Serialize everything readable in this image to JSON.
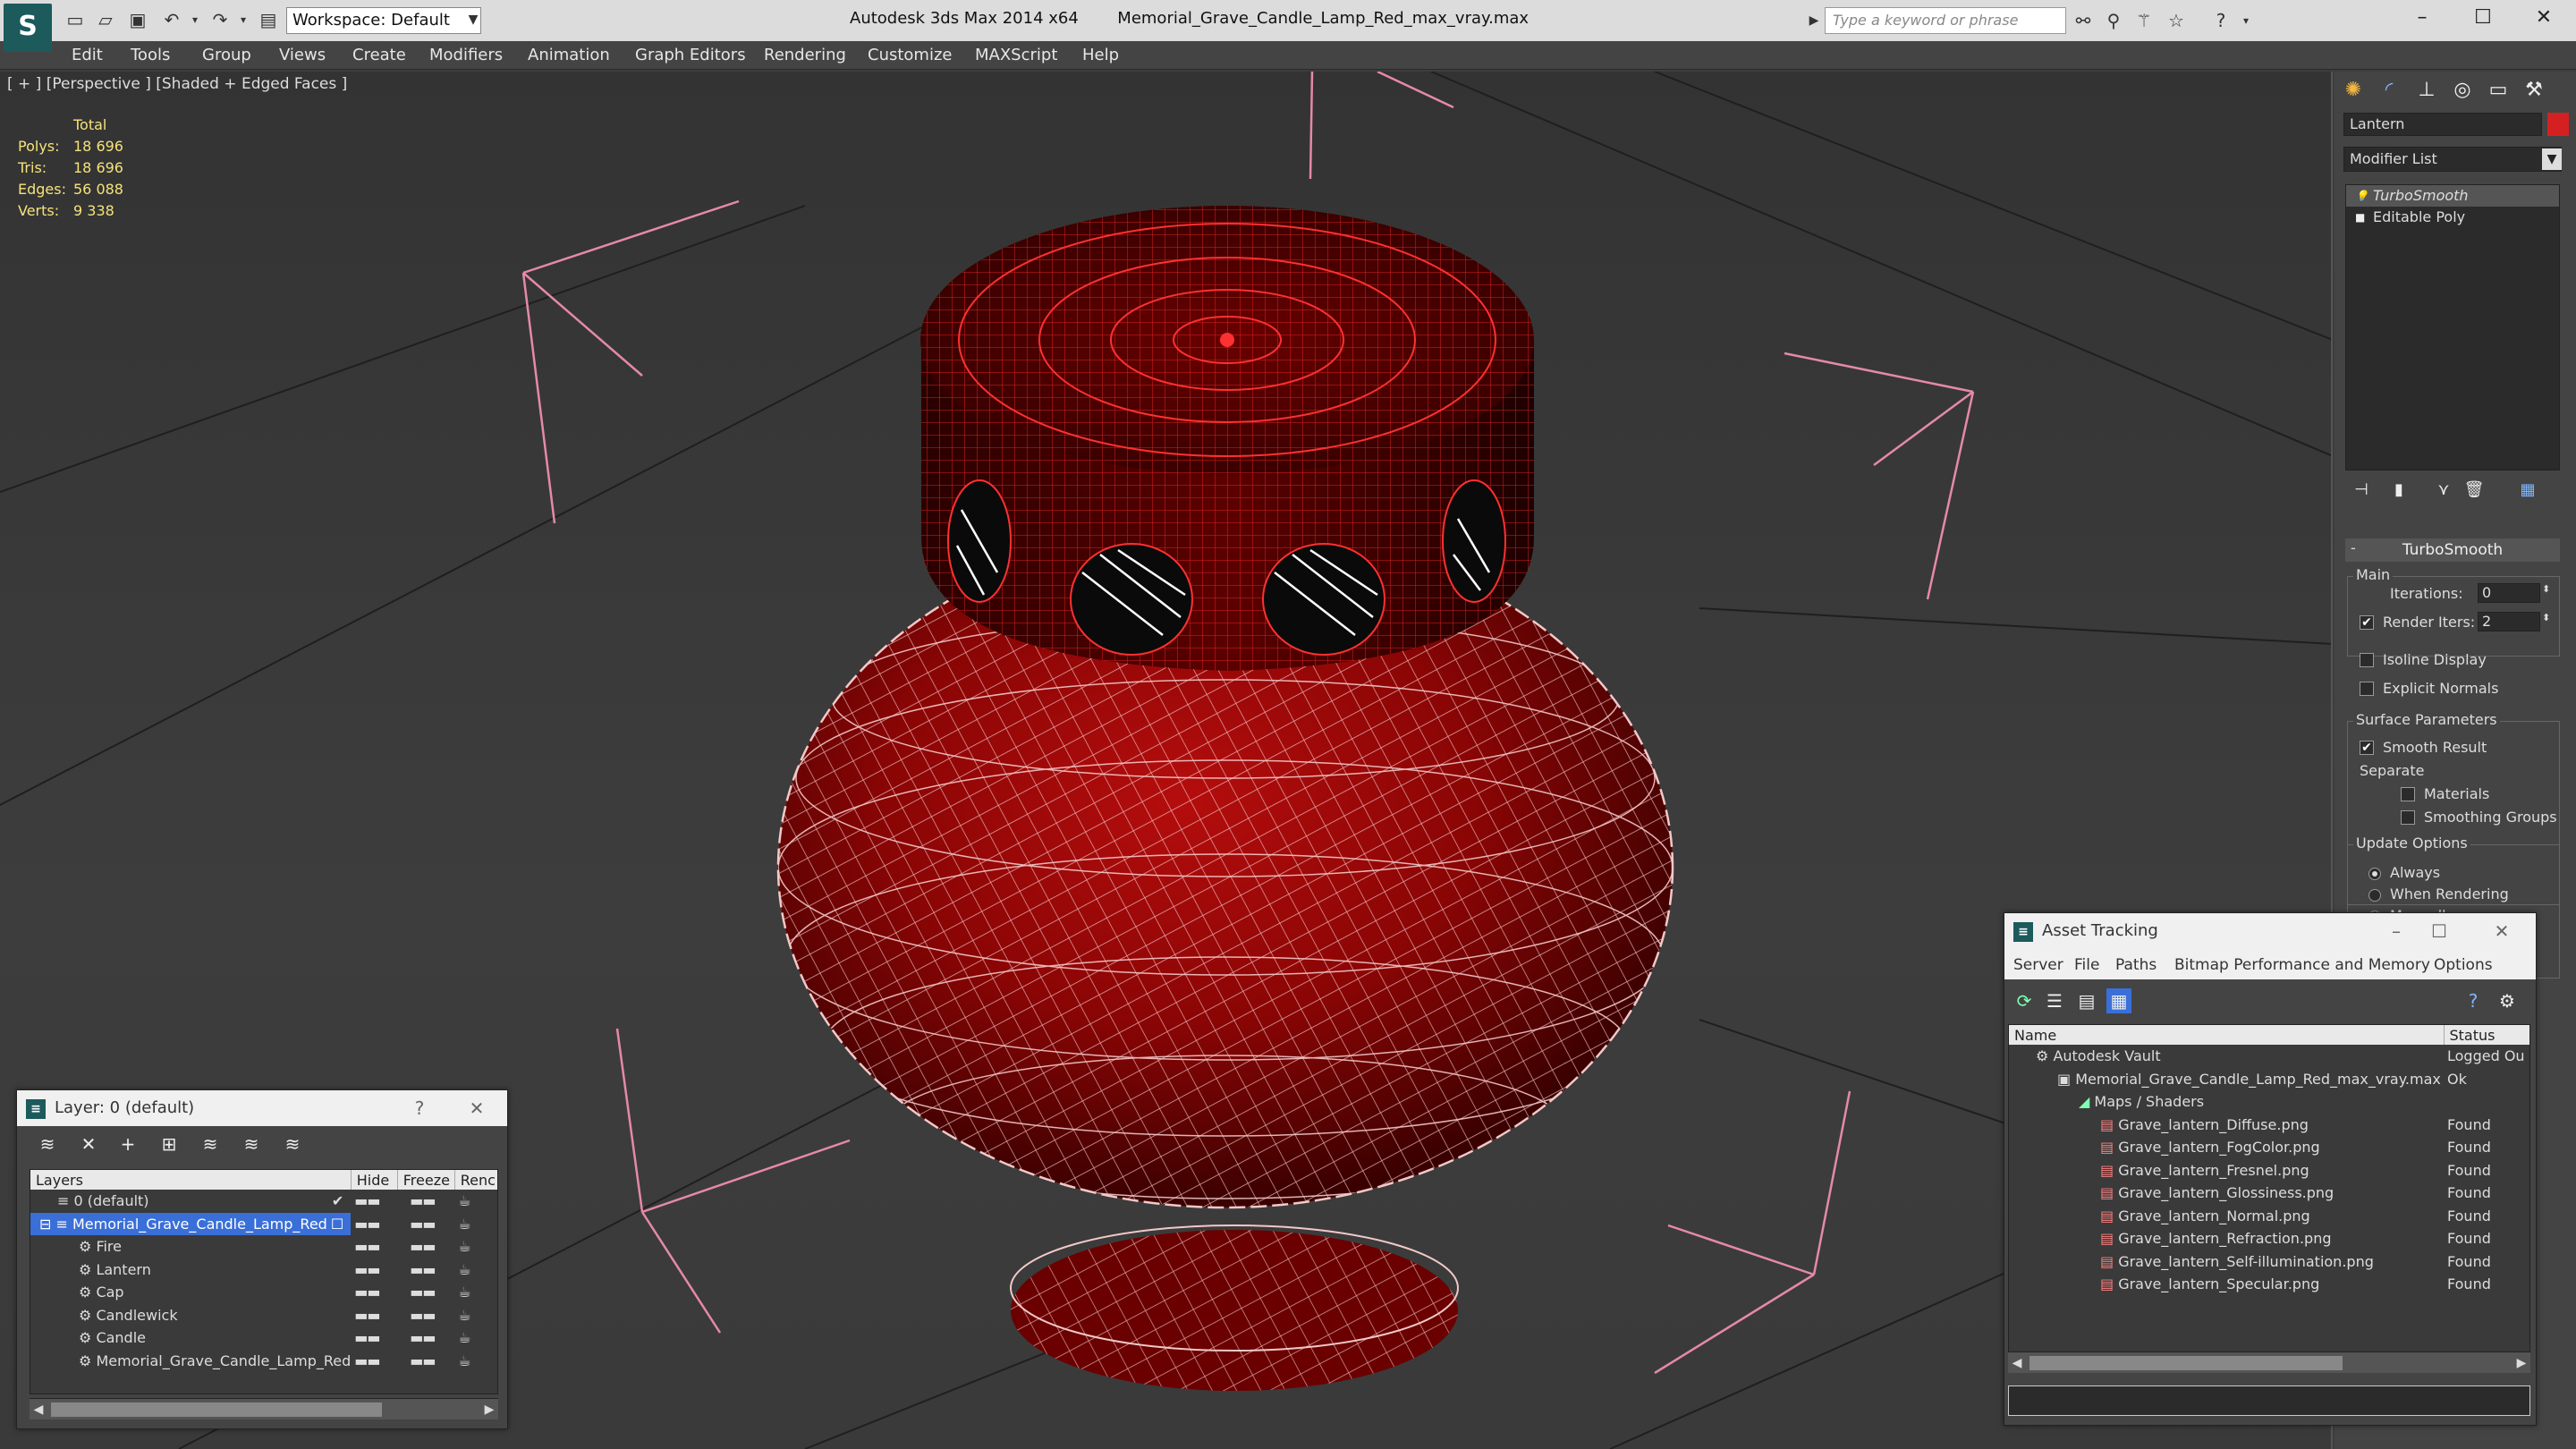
{
  "title_bar": {
    "workspace": "Workspace: Default",
    "app_name": "Autodesk 3ds Max  2014 x64",
    "file_name": "Memorial_Grave_Candle_Lamp_Red_max_vray.max",
    "search_placeholder": "Type a keyword or phrase"
  },
  "menu": [
    "Edit",
    "Tools",
    "Group",
    "Views",
    "Create",
    "Modifiers",
    "Animation",
    "Graph Editors",
    "Rendering",
    "Customize",
    "MAXScript",
    "Help"
  ],
  "viewport": {
    "label": "[ + ] [Perspective ] [Shaded + Edged Faces ]",
    "stats_header": "Total",
    "stats": [
      {
        "k": "Polys:",
        "v": "18 696"
      },
      {
        "k": "Tris:",
        "v": "18 696"
      },
      {
        "k": "Edges:",
        "v": "56 088"
      },
      {
        "k": "Verts:",
        "v": "9 338"
      }
    ]
  },
  "command_panel": {
    "object_name": "Lantern",
    "object_color": "#d42020",
    "modifier_list": "Modifier List",
    "stack": [
      "TurboSmooth",
      "Editable Poly"
    ],
    "rollout_title": "TurboSmooth",
    "main_group": "Main",
    "iterations_label": "Iterations:",
    "iterations_value": "0",
    "render_iters_label": "Render Iters:",
    "render_iters_value": "2",
    "isoline": "Isoline Display",
    "explicit_normals": "Explicit Normals",
    "surface_group": "Surface Parameters",
    "smooth_result": "Smooth Result",
    "separate": "Separate",
    "materials": "Materials",
    "smoothing_groups": "Smoothing Groups",
    "update_group": "Update Options",
    "always": "Always",
    "when_rendering": "When Rendering",
    "manually": "Manually"
  },
  "layer_window": {
    "title": "Layer: 0 (default)",
    "help": "?",
    "columns": [
      "Layers",
      "Hide",
      "Freeze",
      "Renc"
    ],
    "rows": [
      {
        "name": "0 (default)",
        "level": 0,
        "selected": false,
        "check": "✔"
      },
      {
        "name": "Memorial_Grave_Candle_Lamp_Red",
        "level": 0,
        "selected": true,
        "check": "☐"
      },
      {
        "name": "Fire",
        "level": 1,
        "selected": false,
        "check": ""
      },
      {
        "name": "Lantern",
        "level": 1,
        "selected": false,
        "check": ""
      },
      {
        "name": "Cap",
        "level": 1,
        "selected": false,
        "check": ""
      },
      {
        "name": "Candlewick",
        "level": 1,
        "selected": false,
        "check": ""
      },
      {
        "name": "Candle",
        "level": 1,
        "selected": false,
        "check": ""
      },
      {
        "name": "Memorial_Grave_Candle_Lamp_Red",
        "level": 1,
        "selected": false,
        "check": ""
      }
    ]
  },
  "asset_window": {
    "title": "Asset Tracking",
    "menu": [
      "Server",
      "File",
      "Paths",
      "Bitmap Performance and Memory",
      "Options"
    ],
    "columns": [
      "Name",
      "Status"
    ],
    "rows": [
      {
        "name": "Autodesk Vault",
        "status": "Logged Ou",
        "level": 0
      },
      {
        "name": "Memorial_Grave_Candle_Lamp_Red_max_vray.max",
        "status": "Ok",
        "level": 1
      },
      {
        "name": "Maps / Shaders",
        "status": "",
        "level": 2
      },
      {
        "name": "Grave_lantern_Diffuse.png",
        "status": "Found",
        "level": 3
      },
      {
        "name": "Grave_lantern_FogColor.png",
        "status": "Found",
        "level": 3
      },
      {
        "name": "Grave_lantern_Fresnel.png",
        "status": "Found",
        "level": 3
      },
      {
        "name": "Grave_lantern_Glossiness.png",
        "status": "Found",
        "level": 3
      },
      {
        "name": "Grave_lantern_Normal.png",
        "status": "Found",
        "level": 3
      },
      {
        "name": "Grave_lantern_Refraction.png",
        "status": "Found",
        "level": 3
      },
      {
        "name": "Grave_lantern_Self-illumination.png",
        "status": "Found",
        "level": 3
      },
      {
        "name": "Grave_lantern_Specular.png",
        "status": "Found",
        "level": 3
      }
    ]
  }
}
